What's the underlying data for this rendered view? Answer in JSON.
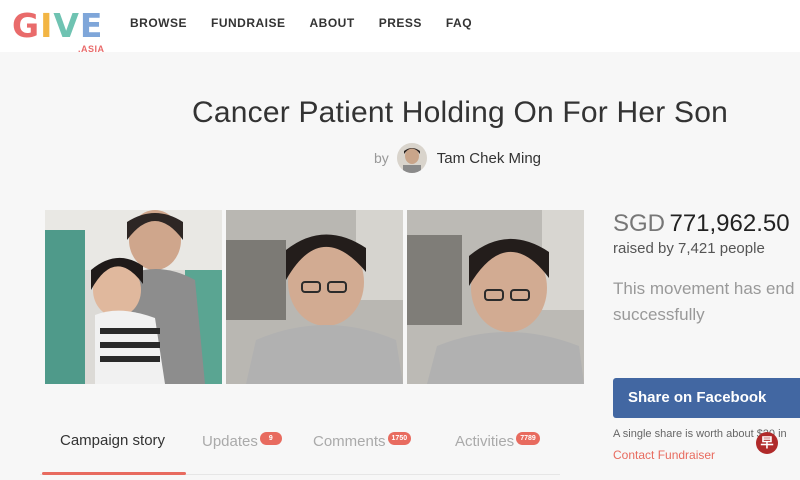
{
  "header": {
    "logo_text": "GIVE",
    "logo_suffix": ".ASIA",
    "nav": [
      "BROWSE",
      "FUNDRAISE",
      "ABOUT",
      "PRESS",
      "FAQ"
    ]
  },
  "campaign": {
    "title": "Cancer Patient Holding On For Her Son",
    "by_label": "by",
    "author": "Tam Chek Ming"
  },
  "tabs": [
    {
      "label": "Campaign story",
      "badge": ""
    },
    {
      "label": "Updates",
      "badge": "9"
    },
    {
      "label": "Comments",
      "badge": "1750"
    },
    {
      "label": "Activities",
      "badge": "7789"
    }
  ],
  "sidebar": {
    "currency": "SGD",
    "amount": "771,962.50",
    "raised_text": "raised by 7,421 people",
    "ended_line1": "This movement has end",
    "ended_line2": "successfully",
    "share_button": "Share on Facebook",
    "share_note": "A single share is worth about $20 in",
    "contact_link": "Contact Fundraiser"
  },
  "watermark": "早",
  "colors": {
    "accent": "#e86b5f",
    "facebook": "#4267a2"
  }
}
